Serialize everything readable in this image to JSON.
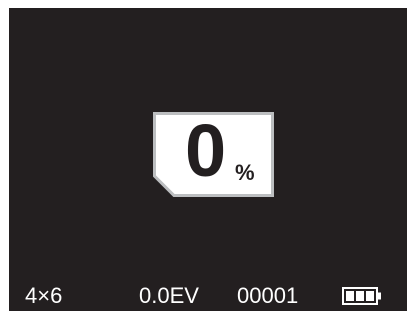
{
  "progress": {
    "value": "0",
    "unit": "%",
    "fraction": 0
  },
  "status_bar": {
    "print_size": "4×6",
    "exposure_compensation": "0.0EV",
    "frame_counter": "00001",
    "battery_icon": "battery-full-icon",
    "battery_level": 1
  },
  "colors": {
    "screen_background": "#231f20",
    "card_fill": "#ffffff",
    "card_border": "#bcbec0",
    "text_light": "#ffffff",
    "text_dark": "#231f20"
  }
}
